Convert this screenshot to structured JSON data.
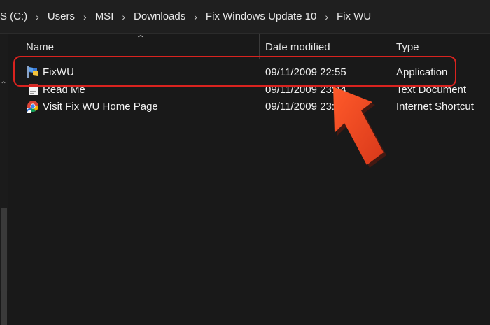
{
  "breadcrumb": [
    {
      "label": "S (C:)"
    },
    {
      "label": "Users"
    },
    {
      "label": "MSI"
    },
    {
      "label": "Downloads"
    },
    {
      "label": "Fix Windows Update 10"
    },
    {
      "label": "Fix WU"
    }
  ],
  "separator_glyph": "›",
  "columns": {
    "name": "Name",
    "date": "Date modified",
    "type": "Type"
  },
  "files": [
    {
      "name": "FixWU",
      "date": "09/11/2009 22:55",
      "type": "Application",
      "icon": "application-flag-icon"
    },
    {
      "name": "Read Me",
      "date": "09/11/2009 23:44",
      "type": "Text Document",
      "icon": "text-document-icon"
    },
    {
      "name": "Visit Fix WU  Home Page",
      "date": "09/11/2009 23:44",
      "type": "Internet Shortcut",
      "icon": "chrome-shortcut-icon"
    }
  ],
  "colors": {
    "background": "#191919",
    "highlight": "#d9231f",
    "arrow": "#e8411e"
  }
}
